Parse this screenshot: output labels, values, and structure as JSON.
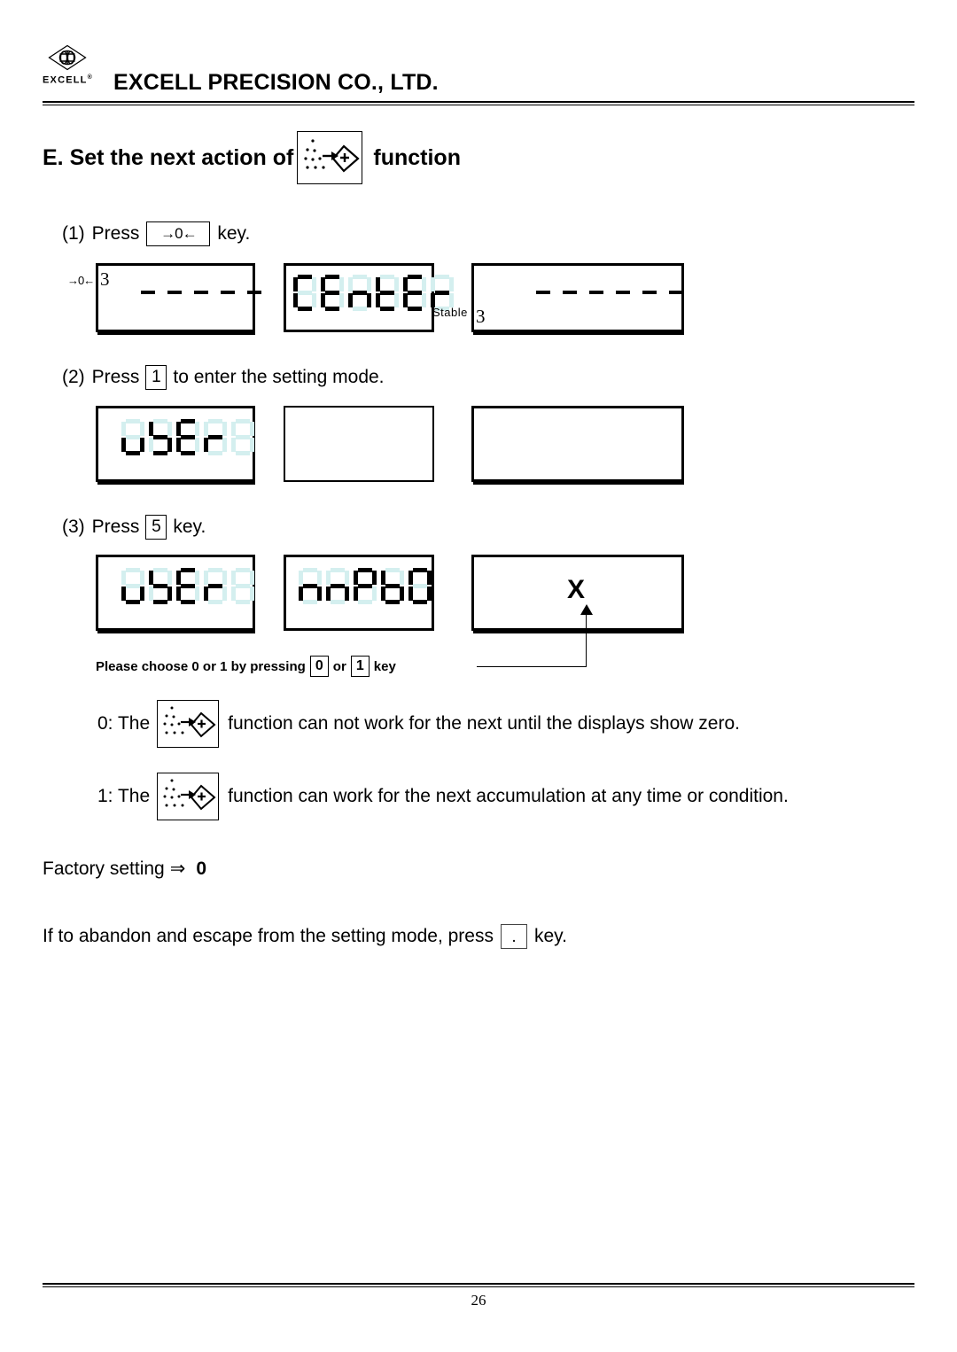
{
  "header": {
    "logo_word": "EXCELL",
    "logo_registered": "®",
    "company_name": "EXCELL PRECISION CO., LTD."
  },
  "section": {
    "title_before": "E. Set the next action of",
    "title_after": "function",
    "icon_name": "accumulation-icon"
  },
  "steps": [
    {
      "number": "(1)",
      "text_before": "Press",
      "key": "→0←",
      "text_after": "key."
    },
    {
      "number": "(2)",
      "text_before": "Press",
      "key": "1",
      "text_after": "to enter the setting mode."
    },
    {
      "number": "(3)",
      "text_before": "Press",
      "key": "5",
      "text_after": "key."
    }
  ],
  "displays": {
    "row1": {
      "panel1": {
        "left_label": "→0←",
        "side_number": "3",
        "content": "dashes",
        "dash_count": 5
      },
      "panel2": {
        "content": "segments",
        "text": "CEntEr",
        "stable_label": "Stable"
      },
      "panel3": {
        "side_number": "3",
        "content": "dashes",
        "dash_count": 6
      }
    },
    "row2": {
      "panel1": {
        "content": "segments",
        "text": "USEr"
      },
      "panel2": {
        "content": "blank"
      },
      "panel3": {
        "content": "blank"
      }
    },
    "row3": {
      "panel1": {
        "content": "segments",
        "text": "USEr"
      },
      "panel2": {
        "content": "segments",
        "text": "nnPb0"
      },
      "panel3": {
        "content": "letter",
        "letter": "X"
      }
    }
  },
  "callout": {
    "text_a": "Please choose 0 or 1 by pressing",
    "key0": "0",
    "text_b": "or",
    "key1": "1",
    "text_c": "key"
  },
  "options": [
    {
      "prefix": "0: The",
      "icon_name": "accumulation-icon",
      "suffix": "function can not work for the next until the displays show zero."
    },
    {
      "prefix": "1: The",
      "icon_name": "accumulation-icon",
      "suffix": "function can work for the next accumulation at any time or condition."
    }
  ],
  "factory": {
    "label": "Factory setting",
    "arrow": "⇒",
    "value": "0"
  },
  "escape": {
    "text_before": "If to abandon and escape from the setting mode, press",
    "key": ".",
    "text_after": "key."
  },
  "footer": {
    "page_number": "26"
  },
  "colors": {
    "ink": "#000000",
    "lcd_off_segment": "#d4efef",
    "paper": "#ffffff"
  }
}
